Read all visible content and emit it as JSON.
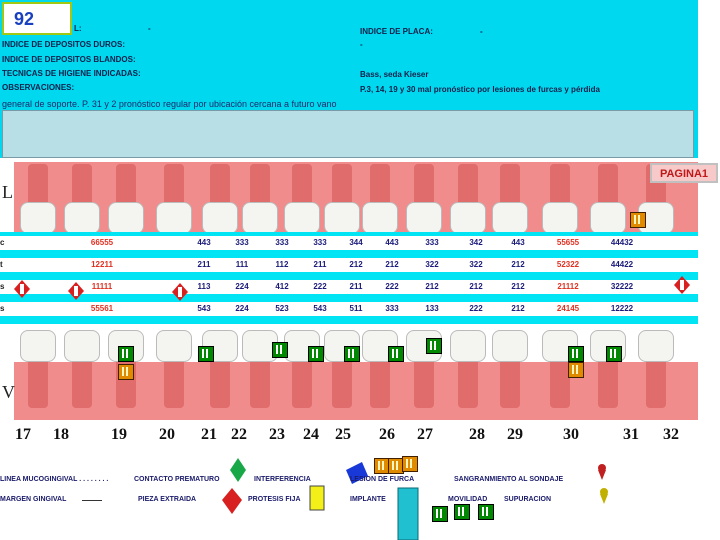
{
  "slide": {
    "number": "92",
    "page_label": "PAGINA1"
  },
  "header": {
    "col1_row1": "L:",
    "col1_row1_val": "-",
    "indice_placa_label": "INDICE DE PLACA:",
    "indice_placa_val": "-",
    "depositos_duros": "INDICE DE DEPOSITOS DUROS:",
    "depositos_duros_val": "-",
    "depositos_blandos": "INDICE DE DEPOSITOS BLANDOS:",
    "tecnicas": "TECNICAS DE HIGIENE INDICADAS:",
    "tecnicas_val": "Bass, seda Kieser",
    "observaciones": "OBSERVACIONES:",
    "observaciones_val": "P.3, 14, 19 y 30 mal pronóstico por lesiones de furcas y pérdida",
    "line2": "general de soporte. P. 31 y 2 pronóstico regular por ubicación cercana a futuro vano"
  },
  "row_labels": {
    "upper": "L",
    "lower": "V"
  },
  "measure_rows": [
    [
      "66555",
      "443",
      "333",
      "333",
      "333",
      "344",
      "443",
      "333",
      "342",
      "443",
      "55655",
      "44432"
    ],
    [
      "12211",
      "211",
      "111",
      "112",
      "211",
      "212",
      "212",
      "322",
      "322",
      "212",
      "52322",
      "44422"
    ],
    [
      "11111",
      "113",
      "224",
      "412",
      "222",
      "211",
      "222",
      "212",
      "212",
      "212",
      "21112",
      "32222"
    ],
    [
      "55561",
      "543",
      "224",
      "523",
      "543",
      "511",
      "333",
      "133",
      "222",
      "212",
      "24145",
      "12222"
    ]
  ],
  "row_prefix": [
    "c",
    "t",
    "s",
    "s"
  ],
  "tooth_numbers": [
    "17",
    "18",
    "19",
    "20",
    "21",
    "22",
    "23",
    "24",
    "25",
    "26",
    "27",
    "28",
    "29",
    "30",
    "31",
    "32"
  ],
  "legend": {
    "mucogingival": "LINEA MUCOGINGIVAL . . . . . . . .",
    "contacto": "CONTACTO PREMATURO",
    "interferencia": "INTERFERENCIA",
    "furca": "LESION DE FURCA",
    "sangrado": "SANGRANMIENTO  AL SONDAJE",
    "margen": "MARGEN GINGIVAL",
    "extraida": "PIEZA EXTRAIDA",
    "protesis": "PROTESIS FIJA",
    "implante": "IMPLANTE",
    "movilidad": "MOVILIDAD",
    "supuracion": "SUPURACION"
  },
  "colors": {
    "header_bg": "#00d8f0",
    "gum": "#f08c8c",
    "accent": "#a0c814"
  }
}
